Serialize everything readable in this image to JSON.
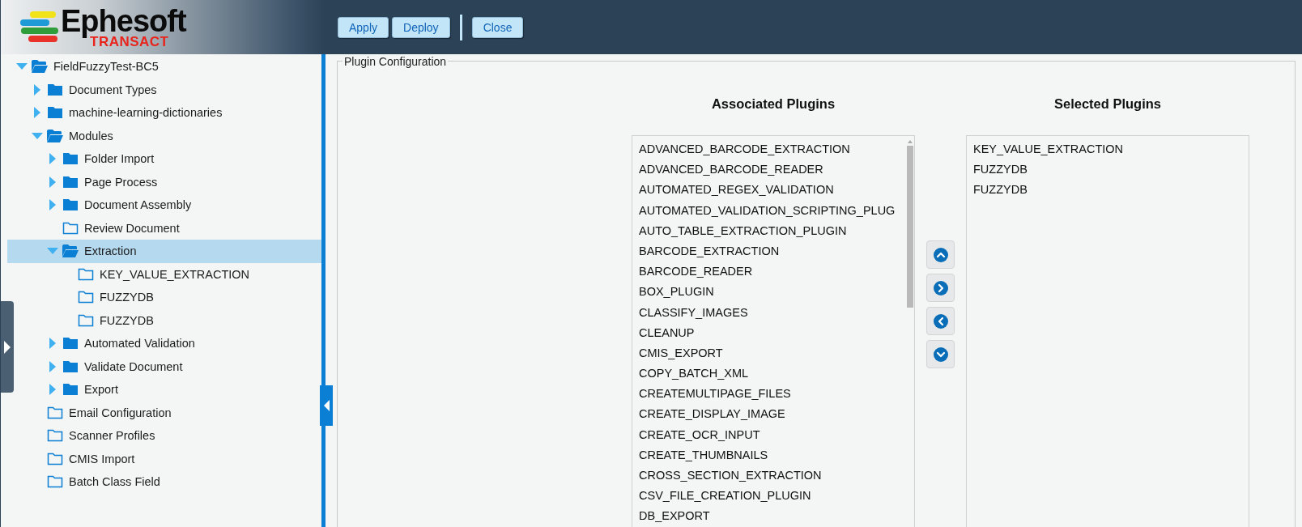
{
  "logo": {
    "name": "Ephesoft",
    "tagline": "TRANSACT"
  },
  "toolbar": {
    "groups": [
      [
        "Apply",
        "Deploy"
      ],
      [
        "Close"
      ]
    ]
  },
  "tree": [
    {
      "label": "FieldFuzzyTest-BC5",
      "kind": "branch",
      "expanded": true,
      "selected": false,
      "children": [
        {
          "label": "Document Types",
          "kind": "branch",
          "expanded": false,
          "selected": false
        },
        {
          "label": "machine-learning-dictionaries",
          "kind": "branch",
          "expanded": false,
          "selected": false
        },
        {
          "label": "Modules",
          "kind": "branch",
          "expanded": true,
          "selected": false,
          "children": [
            {
              "label": "Folder Import",
              "kind": "branch",
              "expanded": false,
              "selected": false
            },
            {
              "label": "Page Process",
              "kind": "branch",
              "expanded": false,
              "selected": false
            },
            {
              "label": "Document Assembly",
              "kind": "branch",
              "expanded": false,
              "selected": false
            },
            {
              "label": "Review Document",
              "kind": "leaf",
              "selected": false
            },
            {
              "label": "Extraction",
              "kind": "branch",
              "expanded": true,
              "selected": true,
              "children": [
                {
                  "label": "KEY_VALUE_EXTRACTION",
                  "kind": "leaf",
                  "selected": false
                },
                {
                  "label": "FUZZYDB",
                  "kind": "leaf",
                  "selected": false
                },
                {
                  "label": "FUZZYDB",
                  "kind": "leaf",
                  "selected": false
                }
              ]
            },
            {
              "label": "Automated Validation",
              "kind": "branch",
              "expanded": false,
              "selected": false
            },
            {
              "label": "Validate Document",
              "kind": "branch",
              "expanded": false,
              "selected": false
            },
            {
              "label": "Export",
              "kind": "branch",
              "expanded": false,
              "selected": false
            }
          ]
        },
        {
          "label": "Email Configuration",
          "kind": "leaf",
          "selected": false
        },
        {
          "label": "Scanner Profiles",
          "kind": "leaf",
          "selected": false
        },
        {
          "label": "CMIS Import",
          "kind": "leaf",
          "selected": false
        },
        {
          "label": "Batch Class Field",
          "kind": "leaf",
          "selected": false
        }
      ]
    }
  ],
  "panel": {
    "legend": "Plugin Configuration",
    "associated": {
      "heading": "Associated Plugins",
      "items": [
        "ADVANCED_BARCODE_EXTRACTION",
        "ADVANCED_BARCODE_READER",
        "AUTOMATED_REGEX_VALIDATION",
        "AUTOMATED_VALIDATION_SCRIPTING_PLUG",
        "AUTO_TABLE_EXTRACTION_PLUGIN",
        "BARCODE_EXTRACTION",
        "BARCODE_READER",
        "BOX_PLUGIN",
        "CLASSIFY_IMAGES",
        "CLEANUP",
        "CMIS_EXPORT",
        "COPY_BATCH_XML",
        "CREATEMULTIPAGE_FILES",
        "CREATE_DISPLAY_IMAGE",
        "CREATE_OCR_INPUT",
        "CREATE_THUMBNAILS",
        "CROSS_SECTION_EXTRACTION",
        "CSV_FILE_CREATION_PLUGIN",
        "DB_EXPORT"
      ]
    },
    "moves": [
      {
        "kind": "up"
      },
      {
        "kind": "right"
      },
      {
        "kind": "left"
      },
      {
        "kind": "down"
      }
    ],
    "selected": {
      "heading": "Selected Plugins",
      "items": [
        "KEY_VALUE_EXTRACTION",
        "FUZZYDB",
        "FUZZYDB"
      ]
    }
  }
}
